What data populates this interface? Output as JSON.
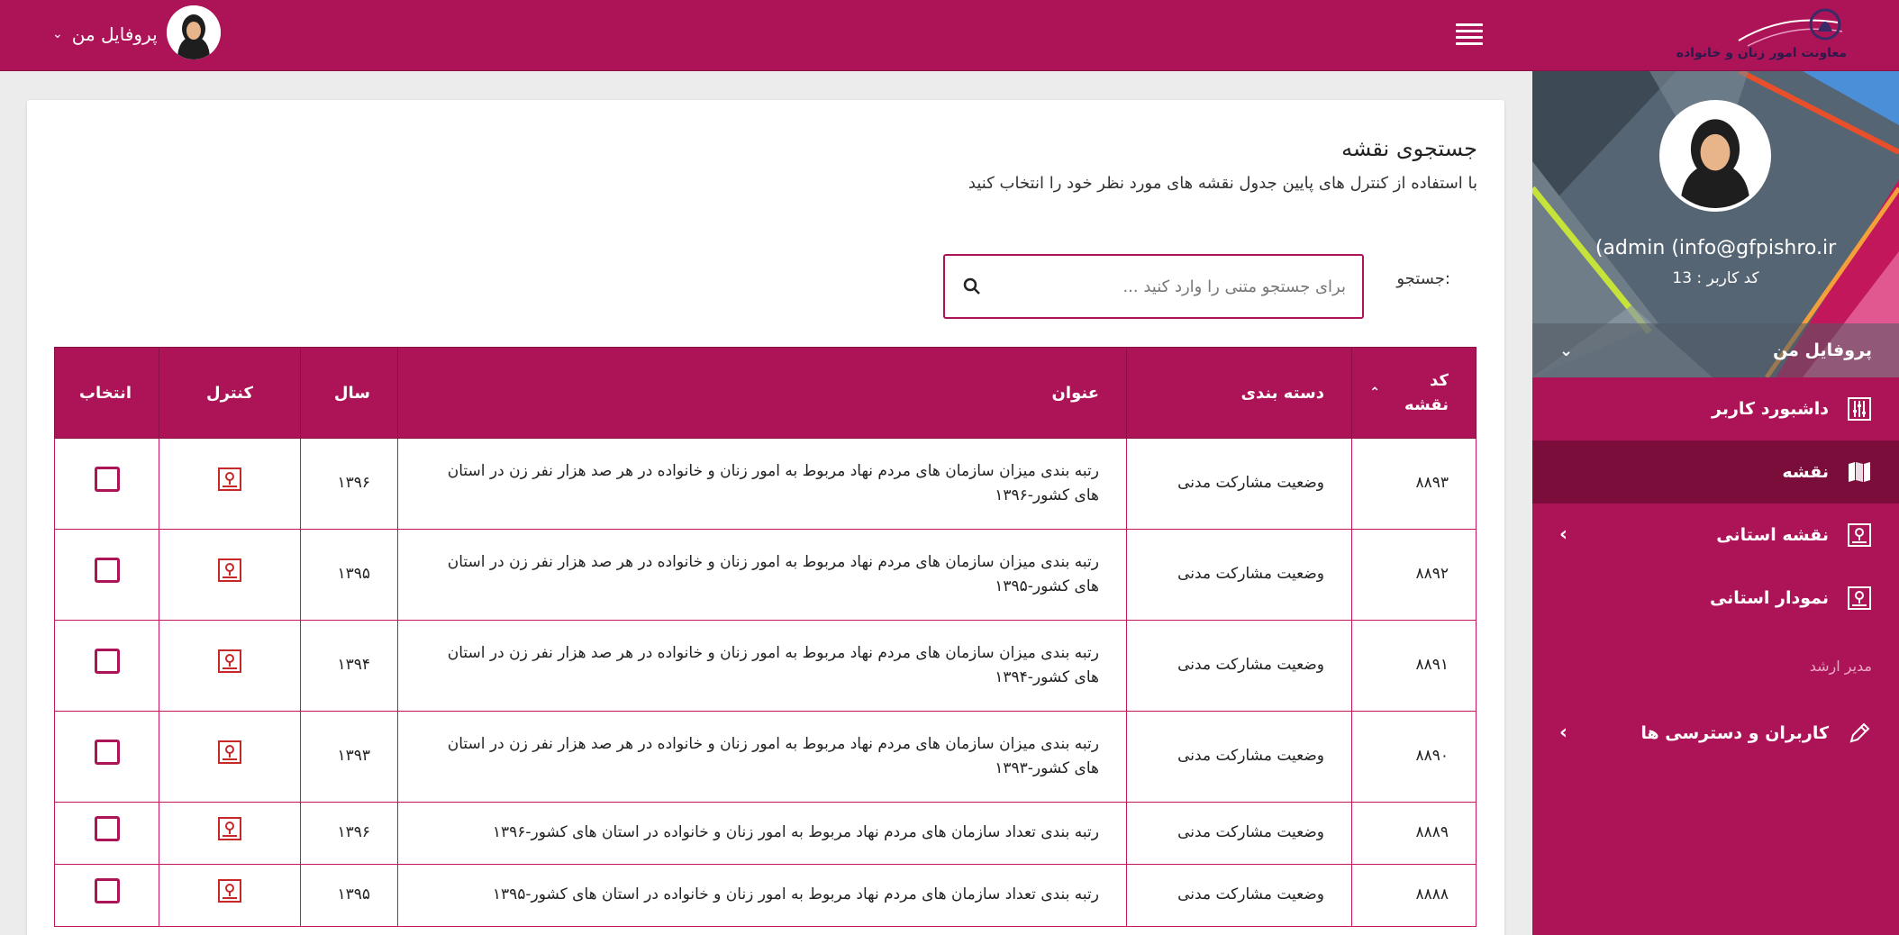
{
  "brand": {
    "logo_text": "معاونت امور زنان و خانواده",
    "accent": "#ad1457",
    "accent_dark": "#7b0d3b"
  },
  "topbar": {
    "profile_label": "پروفایل من",
    "menu_icon": "hamburger-icon"
  },
  "sidebar": {
    "email": "(admin (info@gfpishro.ir",
    "user_code": "کد کاربر : 13",
    "profile_label": "پروفایل من",
    "items": [
      {
        "label": "داشبورد کاربر",
        "icon": "sliders-icon",
        "active": false,
        "has_chevron": false
      },
      {
        "label": "نقشه",
        "icon": "map-icon",
        "active": true,
        "has_chevron": false
      },
      {
        "label": "نقشه استانی",
        "icon": "map-pin-icon",
        "active": false,
        "has_chevron": true
      },
      {
        "label": "نمودار استانی",
        "icon": "map-pin-icon",
        "active": false,
        "has_chevron": false
      }
    ],
    "section_label": "مدیر ارشد",
    "admin_items": [
      {
        "label": "کاربران و دسترسی ها",
        "icon": "pencil-icon",
        "has_chevron": true
      }
    ]
  },
  "main": {
    "title": "جستجوی نقشه",
    "subtitle": "با استفاده از کنترل های پایین جدول نقشه های مورد نظر خود را انتخاب کنید",
    "search": {
      "label": "جستجو:",
      "placeholder": "برای جستجو متنی را وارد کنید ..."
    },
    "table": {
      "headers": {
        "code": "کد نقشه",
        "category": "دسته بندی",
        "title": "عنوان",
        "year": "سال",
        "control": "کنترل",
        "select": "انتخاب"
      },
      "rows": [
        {
          "code": "۸۸۹۳",
          "category": "وضعیت مشارکت مدنی",
          "title": "رتبه بندی میزان سازمان های مردم نهاد مربوط به امور زنان و خانواده در هر صد هزار نفر زن در استان های کشور-۱۳۹۶",
          "year": "۱۳۹۶"
        },
        {
          "code": "۸۸۹۲",
          "category": "وضعیت مشارکت مدنی",
          "title": "رتبه بندی میزان سازمان های مردم نهاد مربوط به امور زنان و خانواده در هر صد هزار نفر زن در استان های کشور-۱۳۹۵",
          "year": "۱۳۹۵"
        },
        {
          "code": "۸۸۹۱",
          "category": "وضعیت مشارکت مدنی",
          "title": "رتبه بندی میزان سازمان های مردم نهاد مربوط به امور زنان و خانواده در هر صد هزار نفر زن در استان های کشور-۱۳۹۴",
          "year": "۱۳۹۴"
        },
        {
          "code": "۸۸۹۰",
          "category": "وضعیت مشارکت مدنی",
          "title": "رتبه بندی میزان سازمان های مردم نهاد مربوط به امور زنان و خانواده در هر صد هزار نفر زن در استان های کشور-۱۳۹۳",
          "year": "۱۳۹۳"
        },
        {
          "code": "۸۸۸۹",
          "category": "وضعیت مشارکت مدنی",
          "title": "رتبه بندی تعداد سازمان های مردم نهاد مربوط به امور زنان و خانواده در استان های کشور-۱۳۹۶",
          "year": "۱۳۹۶"
        },
        {
          "code": "۸۸۸۸",
          "category": "وضعیت مشارکت مدنی",
          "title": "رتبه بندی تعداد سازمان های مردم نهاد مربوط به امور زنان و خانواده در استان های کشور-۱۳۹۵",
          "year": "۱۳۹۵"
        }
      ]
    }
  }
}
